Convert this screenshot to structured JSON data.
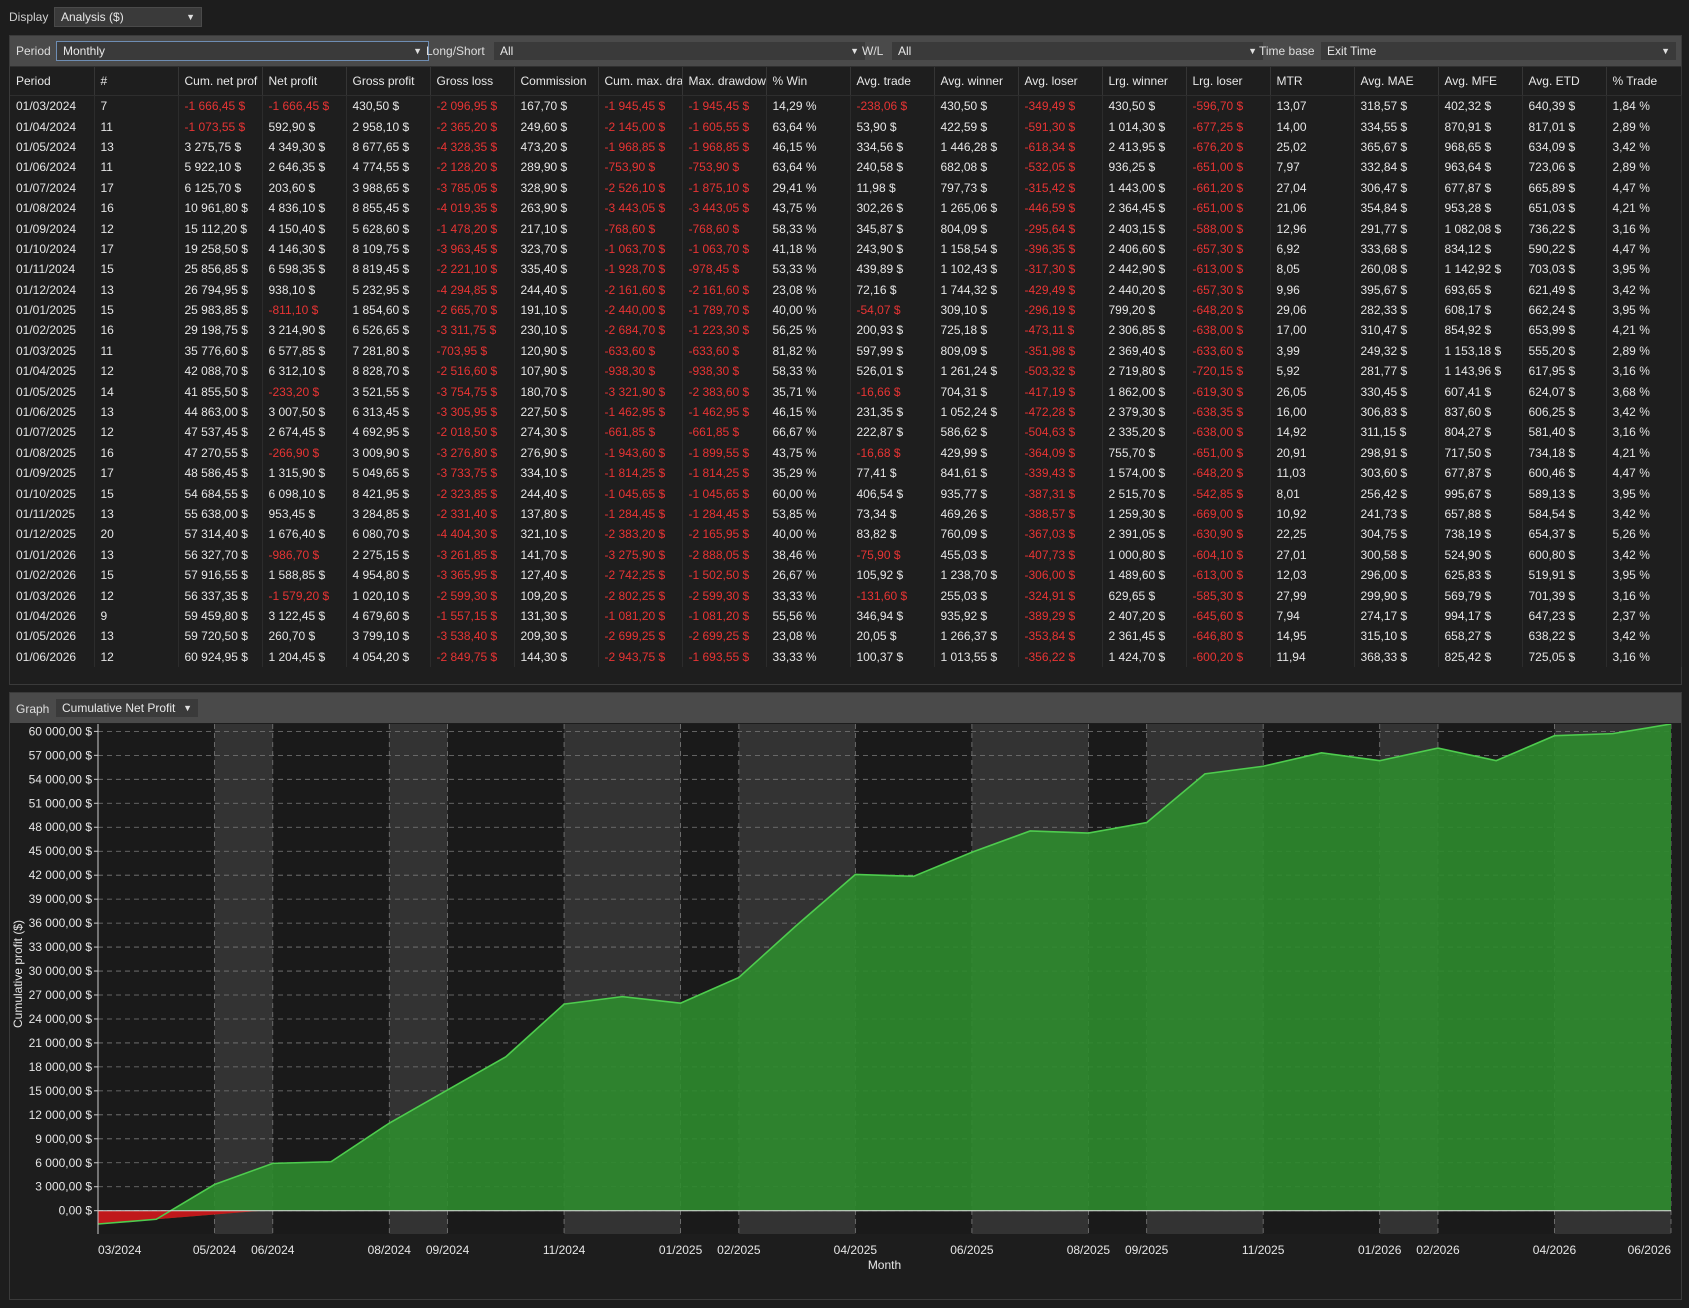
{
  "top": {
    "display_label": "Display",
    "display_value": "Analysis ($)"
  },
  "filters": {
    "period_label": "Period",
    "period_value": "Monthly",
    "longshort_label": "Long/Short",
    "longshort_value": "All",
    "wl_label": "W/L",
    "wl_value": "All",
    "timebase_label": "Time base",
    "timebase_value": "Exit Time"
  },
  "table": {
    "columns": [
      "Period",
      "#",
      "Cum. net prof",
      "Net profit",
      "Gross profit",
      "Gross loss",
      "Commission",
      "Cum. max. dra",
      "Max. drawdow",
      "% Win",
      "Avg. trade",
      "Avg. winner",
      "Avg. loser",
      "Lrg. winner",
      "Lrg. loser",
      "MTR",
      "Avg. MAE",
      "Avg. MFE",
      "Avg. ETD",
      "% Trade"
    ],
    "rows": [
      [
        "01/03/2024",
        "7",
        "-1 666,45 $",
        "-1 666,45 $",
        "430,50 $",
        "-2 096,95 $",
        "167,70 $",
        "-1 945,45 $",
        "-1 945,45 $",
        "14,29 %",
        "-238,06 $",
        "430,50 $",
        "-349,49 $",
        "430,50 $",
        "-596,70 $",
        "13,07",
        "318,57 $",
        "402,32 $",
        "640,39 $",
        "1,84 %"
      ],
      [
        "01/04/2024",
        "11",
        "-1 073,55 $",
        "592,90 $",
        "2 958,10 $",
        "-2 365,20 $",
        "249,60 $",
        "-2 145,00 $",
        "-1 605,55 $",
        "63,64 %",
        "53,90 $",
        "422,59 $",
        "-591,30 $",
        "1 014,30 $",
        "-677,25 $",
        "14,00",
        "334,55 $",
        "870,91 $",
        "817,01 $",
        "2,89 %"
      ],
      [
        "01/05/2024",
        "13",
        "3 275,75 $",
        "4 349,30 $",
        "8 677,65 $",
        "-4 328,35 $",
        "473,20 $",
        "-1 968,85 $",
        "-1 968,85 $",
        "46,15 %",
        "334,56 $",
        "1 446,28 $",
        "-618,34 $",
        "2 413,95 $",
        "-676,20 $",
        "25,02",
        "365,67 $",
        "968,65 $",
        "634,09 $",
        "3,42 %"
      ],
      [
        "01/06/2024",
        "11",
        "5 922,10 $",
        "2 646,35 $",
        "4 774,55 $",
        "-2 128,20 $",
        "289,90 $",
        "-753,90 $",
        "-753,90 $",
        "63,64 %",
        "240,58 $",
        "682,08 $",
        "-532,05 $",
        "936,25 $",
        "-651,00 $",
        "7,97",
        "332,84 $",
        "963,64 $",
        "723,06 $",
        "2,89 %"
      ],
      [
        "01/07/2024",
        "17",
        "6 125,70 $",
        "203,60 $",
        "3 988,65 $",
        "-3 785,05 $",
        "328,90 $",
        "-2 526,10 $",
        "-1 875,10 $",
        "29,41 %",
        "11,98 $",
        "797,73 $",
        "-315,42 $",
        "1 443,00 $",
        "-661,20 $",
        "27,04",
        "306,47 $",
        "677,87 $",
        "665,89 $",
        "4,47 %"
      ],
      [
        "01/08/2024",
        "16",
        "10 961,80 $",
        "4 836,10 $",
        "8 855,45 $",
        "-4 019,35 $",
        "263,90 $",
        "-3 443,05 $",
        "-3 443,05 $",
        "43,75 %",
        "302,26 $",
        "1 265,06 $",
        "-446,59 $",
        "2 364,45 $",
        "-651,00 $",
        "21,06",
        "354,84 $",
        "953,28 $",
        "651,03 $",
        "4,21 %"
      ],
      [
        "01/09/2024",
        "12",
        "15 112,20 $",
        "4 150,40 $",
        "5 628,60 $",
        "-1 478,20 $",
        "217,10 $",
        "-768,60 $",
        "-768,60 $",
        "58,33 %",
        "345,87 $",
        "804,09 $",
        "-295,64 $",
        "2 403,15 $",
        "-588,00 $",
        "12,96",
        "291,77 $",
        "1 082,08 $",
        "736,22 $",
        "3,16 %"
      ],
      [
        "01/10/2024",
        "17",
        "19 258,50 $",
        "4 146,30 $",
        "8 109,75 $",
        "-3 963,45 $",
        "323,70 $",
        "-1 063,70 $",
        "-1 063,70 $",
        "41,18 %",
        "243,90 $",
        "1 158,54 $",
        "-396,35 $",
        "2 406,60 $",
        "-657,30 $",
        "6,92",
        "333,68 $",
        "834,12 $",
        "590,22 $",
        "4,47 %"
      ],
      [
        "01/11/2024",
        "15",
        "25 856,85 $",
        "6 598,35 $",
        "8 819,45 $",
        "-2 221,10 $",
        "335,40 $",
        "-1 928,70 $",
        "-978,45 $",
        "53,33 %",
        "439,89 $",
        "1 102,43 $",
        "-317,30 $",
        "2 442,90 $",
        "-613,00 $",
        "8,05",
        "260,08 $",
        "1 142,92 $",
        "703,03 $",
        "3,95 %"
      ],
      [
        "01/12/2024",
        "13",
        "26 794,95 $",
        "938,10 $",
        "5 232,95 $",
        "-4 294,85 $",
        "244,40 $",
        "-2 161,60 $",
        "-2 161,60 $",
        "23,08 %",
        "72,16 $",
        "1 744,32 $",
        "-429,49 $",
        "2 440,20 $",
        "-657,30 $",
        "9,96",
        "395,67 $",
        "693,65 $",
        "621,49 $",
        "3,42 %"
      ],
      [
        "01/01/2025",
        "15",
        "25 983,85 $",
        "-811,10 $",
        "1 854,60 $",
        "-2 665,70 $",
        "191,10 $",
        "-2 440,00 $",
        "-1 789,70 $",
        "40,00 %",
        "-54,07 $",
        "309,10 $",
        "-296,19 $",
        "799,20 $",
        "-648,20 $",
        "29,06",
        "282,33 $",
        "608,17 $",
        "662,24 $",
        "3,95 %"
      ],
      [
        "01/02/2025",
        "16",
        "29 198,75 $",
        "3 214,90 $",
        "6 526,65 $",
        "-3 311,75 $",
        "230,10 $",
        "-2 684,70 $",
        "-1 223,30 $",
        "56,25 %",
        "200,93 $",
        "725,18 $",
        "-473,11 $",
        "2 306,85 $",
        "-638,00 $",
        "17,00",
        "310,47 $",
        "854,92 $",
        "653,99 $",
        "4,21 %"
      ],
      [
        "01/03/2025",
        "11",
        "35 776,60 $",
        "6 577,85 $",
        "7 281,80 $",
        "-703,95 $",
        "120,90 $",
        "-633,60 $",
        "-633,60 $",
        "81,82 %",
        "597,99 $",
        "809,09 $",
        "-351,98 $",
        "2 369,40 $",
        "-633,60 $",
        "3,99",
        "249,32 $",
        "1 153,18 $",
        "555,20 $",
        "2,89 %"
      ],
      [
        "01/04/2025",
        "12",
        "42 088,70 $",
        "6 312,10 $",
        "8 828,70 $",
        "-2 516,60 $",
        "107,90 $",
        "-938,30 $",
        "-938,30 $",
        "58,33 %",
        "526,01 $",
        "1 261,24 $",
        "-503,32 $",
        "2 719,80 $",
        "-720,15 $",
        "5,92",
        "281,77 $",
        "1 143,96 $",
        "617,95 $",
        "3,16 %"
      ],
      [
        "01/05/2025",
        "14",
        "41 855,50 $",
        "-233,20 $",
        "3 521,55 $",
        "-3 754,75 $",
        "180,70 $",
        "-3 321,90 $",
        "-2 383,60 $",
        "35,71 %",
        "-16,66 $",
        "704,31 $",
        "-417,19 $",
        "1 862,00 $",
        "-619,30 $",
        "26,05",
        "330,45 $",
        "607,41 $",
        "624,07 $",
        "3,68 %"
      ],
      [
        "01/06/2025",
        "13",
        "44 863,00 $",
        "3 007,50 $",
        "6 313,45 $",
        "-3 305,95 $",
        "227,50 $",
        "-1 462,95 $",
        "-1 462,95 $",
        "46,15 %",
        "231,35 $",
        "1 052,24 $",
        "-472,28 $",
        "2 379,30 $",
        "-638,35 $",
        "16,00",
        "306,83 $",
        "837,60 $",
        "606,25 $",
        "3,42 %"
      ],
      [
        "01/07/2025",
        "12",
        "47 537,45 $",
        "2 674,45 $",
        "4 692,95 $",
        "-2 018,50 $",
        "274,30 $",
        "-661,85 $",
        "-661,85 $",
        "66,67 %",
        "222,87 $",
        "586,62 $",
        "-504,63 $",
        "2 335,20 $",
        "-638,00 $",
        "14,92",
        "311,15 $",
        "804,27 $",
        "581,40 $",
        "3,16 %"
      ],
      [
        "01/08/2025",
        "16",
        "47 270,55 $",
        "-266,90 $",
        "3 009,90 $",
        "-3 276,80 $",
        "276,90 $",
        "-1 943,60 $",
        "-1 899,55 $",
        "43,75 %",
        "-16,68 $",
        "429,99 $",
        "-364,09 $",
        "755,70 $",
        "-651,00 $",
        "20,91",
        "298,91 $",
        "717,50 $",
        "734,18 $",
        "4,21 %"
      ],
      [
        "01/09/2025",
        "17",
        "48 586,45 $",
        "1 315,90 $",
        "5 049,65 $",
        "-3 733,75 $",
        "334,10 $",
        "-1 814,25 $",
        "-1 814,25 $",
        "35,29 %",
        "77,41 $",
        "841,61 $",
        "-339,43 $",
        "1 574,00 $",
        "-648,20 $",
        "11,03",
        "303,60 $",
        "677,87 $",
        "600,46 $",
        "4,47 %"
      ],
      [
        "01/10/2025",
        "15",
        "54 684,55 $",
        "6 098,10 $",
        "8 421,95 $",
        "-2 323,85 $",
        "244,40 $",
        "-1 045,65 $",
        "-1 045,65 $",
        "60,00 %",
        "406,54 $",
        "935,77 $",
        "-387,31 $",
        "2 515,70 $",
        "-542,85 $",
        "8,01",
        "256,42 $",
        "995,67 $",
        "589,13 $",
        "3,95 %"
      ],
      [
        "01/11/2025",
        "13",
        "55 638,00 $",
        "953,45 $",
        "3 284,85 $",
        "-2 331,40 $",
        "137,80 $",
        "-1 284,45 $",
        "-1 284,45 $",
        "53,85 %",
        "73,34 $",
        "469,26 $",
        "-388,57 $",
        "1 259,30 $",
        "-669,00 $",
        "10,92",
        "241,73 $",
        "657,88 $",
        "584,54 $",
        "3,42 %"
      ],
      [
        "01/12/2025",
        "20",
        "57 314,40 $",
        "1 676,40 $",
        "6 080,70 $",
        "-4 404,30 $",
        "321,10 $",
        "-2 383,20 $",
        "-2 165,95 $",
        "40,00 %",
        "83,82 $",
        "760,09 $",
        "-367,03 $",
        "2 391,05 $",
        "-630,90 $",
        "22,25",
        "304,75 $",
        "738,19 $",
        "654,37 $",
        "5,26 %"
      ],
      [
        "01/01/2026",
        "13",
        "56 327,70 $",
        "-986,70 $",
        "2 275,15 $",
        "-3 261,85 $",
        "141,70 $",
        "-3 275,90 $",
        "-2 888,05 $",
        "38,46 %",
        "-75,90 $",
        "455,03 $",
        "-407,73 $",
        "1 000,80 $",
        "-604,10 $",
        "27,01",
        "300,58 $",
        "524,90 $",
        "600,80 $",
        "3,42 %"
      ],
      [
        "01/02/2026",
        "15",
        "57 916,55 $",
        "1 588,85 $",
        "4 954,80 $",
        "-3 365,95 $",
        "127,40 $",
        "-2 742,25 $",
        "-1 502,50 $",
        "26,67 %",
        "105,92 $",
        "1 238,70 $",
        "-306,00 $",
        "1 489,60 $",
        "-613,00 $",
        "12,03",
        "296,00 $",
        "625,83 $",
        "519,91 $",
        "3,95 %"
      ],
      [
        "01/03/2026",
        "12",
        "56 337,35 $",
        "-1 579,20 $",
        "1 020,10 $",
        "-2 599,30 $",
        "109,20 $",
        "-2 802,25 $",
        "-2 599,30 $",
        "33,33 %",
        "-131,60 $",
        "255,03 $",
        "-324,91 $",
        "629,65 $",
        "-585,30 $",
        "27,99",
        "299,90 $",
        "569,79 $",
        "701,39 $",
        "3,16 %"
      ],
      [
        "01/04/2026",
        "9",
        "59 459,80 $",
        "3 122,45 $",
        "4 679,60 $",
        "-1 557,15 $",
        "131,30 $",
        "-1 081,20 $",
        "-1 081,20 $",
        "55,56 %",
        "346,94 $",
        "935,92 $",
        "-389,29 $",
        "2 407,20 $",
        "-645,60 $",
        "7,94",
        "274,17 $",
        "994,17 $",
        "647,23 $",
        "2,37 %"
      ],
      [
        "01/05/2026",
        "13",
        "59 720,50 $",
        "260,70 $",
        "3 799,10 $",
        "-3 538,40 $",
        "209,30 $",
        "-2 699,25 $",
        "-2 699,25 $",
        "23,08 %",
        "20,05 $",
        "1 266,37 $",
        "-353,84 $",
        "2 361,45 $",
        "-646,80 $",
        "14,95",
        "315,10 $",
        "658,27 $",
        "638,22 $",
        "3,42 %"
      ],
      [
        "01/06/2026",
        "12",
        "60 924,95 $",
        "1 204,45 $",
        "4 054,20 $",
        "-2 849,75 $",
        "144,30 $",
        "-2 943,75 $",
        "-1 693,55 $",
        "33,33 %",
        "100,37 $",
        "1 013,55 $",
        "-356,22 $",
        "1 424,70 $",
        "-600,20 $",
        "11,94",
        "368,33 $",
        "825,42 $",
        "725,05 $",
        "3,16 %"
      ]
    ]
  },
  "graph": {
    "label": "Graph",
    "value": "Cumulative Net Profit"
  },
  "colors": {
    "positive_fill": "#2e8b2e",
    "positive_line": "#4ecc4e",
    "negative_fill": "#c0181b",
    "negative_text": "#e83434",
    "shade": "#333333"
  },
  "chart_data": {
    "type": "area",
    "xlabel": "Month",
    "ylabel": "Cumulative profit ($)",
    "x": [
      "03/2024",
      "04/2024",
      "05/2024",
      "06/2024",
      "07/2024",
      "08/2024",
      "09/2024",
      "10/2024",
      "11/2024",
      "12/2024",
      "01/2025",
      "02/2025",
      "03/2025",
      "04/2025",
      "05/2025",
      "06/2025",
      "07/2025",
      "08/2025",
      "09/2025",
      "10/2025",
      "11/2025",
      "12/2025",
      "01/2026",
      "02/2026",
      "03/2026",
      "04/2026",
      "05/2026",
      "06/2026"
    ],
    "x_tick_labels": [
      "03/2024",
      "05/2024",
      "06/2024",
      "08/2024",
      "09/2024",
      "11/2024",
      "01/2025",
      "02/2025",
      "04/2025",
      "06/2025",
      "08/2025",
      "09/2025",
      "11/2025",
      "01/2026",
      "02/2026",
      "04/2026",
      "06/2026"
    ],
    "values": [
      -1666.45,
      -1073.55,
      3275.75,
      5922.1,
      6125.7,
      10961.8,
      15112.2,
      19258.5,
      25856.85,
      26794.95,
      25983.85,
      29198.75,
      35776.6,
      42088.7,
      41855.5,
      44863.0,
      47537.45,
      47270.55,
      48586.45,
      54684.55,
      55638.0,
      57314.4,
      56327.7,
      57916.55,
      56337.35,
      59459.8,
      59720.5,
      60924.95
    ],
    "ylim": [
      -1666.45,
      60924.95
    ],
    "y_ticks": [
      "0,00 $",
      "3 000,00 $",
      "6 000,00 $",
      "9 000,00 $",
      "12 000,00 $",
      "15 000,00 $",
      "18 000,00 $",
      "21 000,00 $",
      "24 000,00 $",
      "27 000,00 $",
      "30 000,00 $",
      "33 000,00 $",
      "36 000,00 $",
      "39 000,00 $",
      "42 000,00 $",
      "45 000,00 $",
      "48 000,00 $",
      "51 000,00 $",
      "54 000,00 $",
      "57 000,00 $",
      "60 000,00 $"
    ],
    "grid": true
  }
}
